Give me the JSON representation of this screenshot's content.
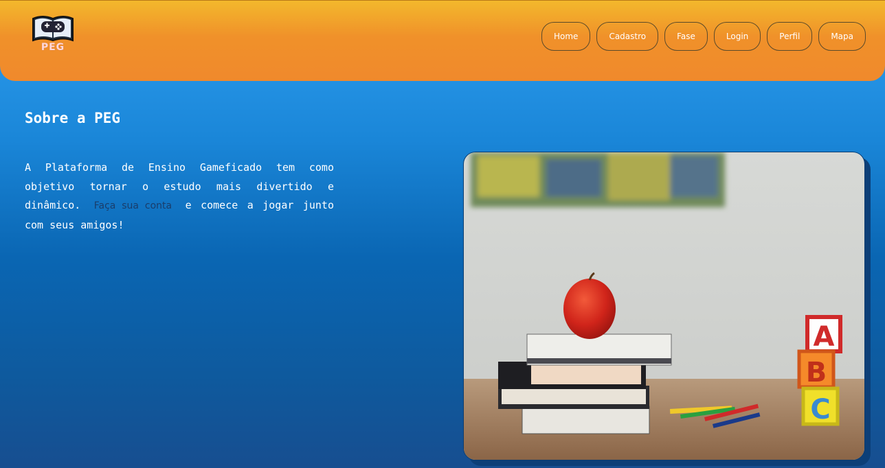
{
  "header": {
    "logo_text": "PEG",
    "nav": [
      {
        "label": "Home"
      },
      {
        "label": "Cadastro"
      },
      {
        "label": "Fase"
      },
      {
        "label": "Login"
      },
      {
        "label": "Perfil"
      },
      {
        "label": "Mapa"
      }
    ]
  },
  "about": {
    "title": "Sobre a PEG",
    "text_before": "A Plataforma de Ensino Gameficado tem como objetivo tornar o estudo mais divertido e dinâmico.",
    "link_text": "Faça sua conta",
    "text_after": "e comece a jogar junto com seus amigos!"
  },
  "image": {
    "subject": "apple-on-books-with-abc-blocks",
    "blocks": [
      "A",
      "B",
      "C"
    ]
  },
  "colors": {
    "header_top": "#f3b82c",
    "header_bottom": "#f0892c",
    "bg_top": "#2f9ff0",
    "bg_bottom": "#174e90"
  }
}
